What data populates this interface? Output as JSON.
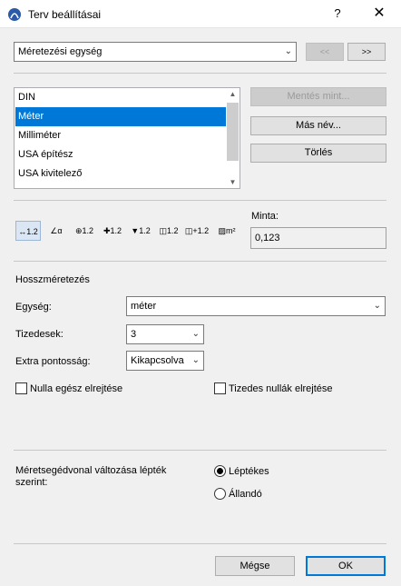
{
  "window": {
    "title": "Terv beállításai",
    "help": "?",
    "close": "✕"
  },
  "preset": {
    "selected": "Méretezési egység",
    "prev_label": "<<",
    "next_label": ">>"
  },
  "list": {
    "items": [
      "DIN",
      "Méter",
      "Milliméter",
      "USA építész",
      "USA kivitelező"
    ],
    "selected_index": 1
  },
  "side_buttons": {
    "save_as": "Mentés mint...",
    "rename": "Más név...",
    "delete": "Törlés"
  },
  "toolbar": {
    "tools": [
      {
        "icon": "linear-dimension-icon",
        "glyph": "↔1.2"
      },
      {
        "icon": "angle-dimension-icon",
        "glyph": "∠α"
      },
      {
        "icon": "radial-dimension-icon",
        "glyph": "⊕1.2"
      },
      {
        "icon": "level-dimension-icon",
        "glyph": "✚1.2"
      },
      {
        "icon": "elevation-dimension-icon",
        "glyph": "▼1.2"
      },
      {
        "icon": "door-window-dimension-icon",
        "glyph": "◫1.2"
      },
      {
        "icon": "sill-height-dimension-icon",
        "glyph": "◫+1.2"
      },
      {
        "icon": "area-dimension-icon",
        "glyph": "▨m²"
      }
    ],
    "sample_label": "Minta:",
    "sample_value": "0,123"
  },
  "length": {
    "section_title": "Hosszméretezés",
    "unit_label": "Egység:",
    "unit_value": "méter",
    "decimals_label": "Tizedesek:",
    "decimals_value": "3",
    "extra_label": "Extra pontosság:",
    "extra_value": "Kikapcsolva",
    "hide_zero_int": "Nulla egész elrejtése",
    "hide_zero_dec": "Tizedes nullák elrejtése"
  },
  "scale": {
    "label": "Méretsegédvonal változása lépték szerint:",
    "option_scaled": "Léptékes",
    "option_fixed": "Állandó",
    "selected": "scaled"
  },
  "footer": {
    "cancel": "Mégse",
    "ok": "OK"
  },
  "colors": {
    "accent": "#0078d7"
  }
}
